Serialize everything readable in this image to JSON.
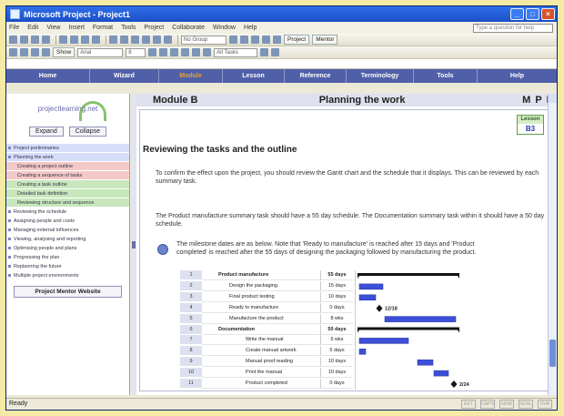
{
  "window": {
    "title": "Microsoft Project - Project1"
  },
  "menu": {
    "items": [
      "File",
      "Edit",
      "View",
      "Insert",
      "Format",
      "Tools",
      "Project",
      "Collaborate",
      "Window",
      "Help"
    ],
    "help_placeholder": "Type a question for help"
  },
  "toolbar": {
    "group_select": "No Group",
    "show_label": "Show",
    "font_select": "Arial",
    "size_select": "8",
    "filter_select": "All Tasks",
    "project_button": "Project",
    "mentor_button": "Mentor"
  },
  "nav": {
    "items": [
      "Home",
      "Wizard",
      "Module",
      "Lesson",
      "Reference",
      "Terminology",
      "Tools",
      "Help"
    ]
  },
  "sidebar": {
    "logo_text": "projectlearning.net",
    "expand_label": "Expand",
    "collapse_label": "Collapse",
    "items": [
      {
        "label": "Project preliminaries",
        "style": "blue",
        "sub": false
      },
      {
        "label": "Planning the work",
        "style": "blue",
        "sub": false
      },
      {
        "label": "Creating a project outline",
        "style": "red",
        "sub": true
      },
      {
        "label": "Creating a sequence of tasks",
        "style": "red",
        "sub": true
      },
      {
        "label": "Creating a task outline",
        "style": "green",
        "sub": true
      },
      {
        "label": "Detailed task definition",
        "style": "green",
        "sub": true
      },
      {
        "label": "Reviewing structure and sequence",
        "style": "green",
        "sub": true
      },
      {
        "label": "Reviewing the schedule",
        "style": "",
        "sub": false
      },
      {
        "label": "Assigning people and costs",
        "style": "",
        "sub": false
      },
      {
        "label": "Managing external influences",
        "style": "",
        "sub": false
      },
      {
        "label": "Viewing, analysing and reporting",
        "style": "",
        "sub": false
      },
      {
        "label": "Optimising people and plans",
        "style": "",
        "sub": false
      },
      {
        "label": "Progressing the plan",
        "style": "",
        "sub": false
      },
      {
        "label": "Replanning the future",
        "style": "",
        "sub": false
      },
      {
        "label": "Multiple project environments",
        "style": "",
        "sub": false
      }
    ],
    "website_button": "Project Mentor Website"
  },
  "content": {
    "module_label": "Module B",
    "page_title": "Planning the work",
    "mpe": [
      "M",
      "P",
      "E"
    ],
    "lesson_label": "Lesson",
    "lesson_number": "B3",
    "heading": "Reviewing the tasks and the outline",
    "para1": "To confirm the effect upon the project, you should review the Gantt chart and the schedule that it displays. This can be reviewed by each summary task.",
    "para2": "The Product manufacture summary task should have a 55 day schedule.  The Documentation summary task within it should have a 50 day schedule.",
    "para3": "The milestone dates are as below.  Note that 'Ready to manufacture' is reached after 15 days and 'Product completed' is reached after the 55 days of designing the packaging followed by manufacturing the product."
  },
  "gantt": {
    "tasks": [
      {
        "id": "1",
        "name": "Product manufacture",
        "duration": "55 days",
        "summary": true
      },
      {
        "id": "2",
        "name": "Design the packaging",
        "duration": "15 days",
        "summary": false
      },
      {
        "id": "3",
        "name": "Final product testing",
        "duration": "10 days",
        "summary": false
      },
      {
        "id": "4",
        "name": "Ready to manufacture",
        "duration": "0 days",
        "summary": false
      },
      {
        "id": "5",
        "name": "Manufacture the product",
        "duration": "8 wks",
        "summary": false
      },
      {
        "id": "6",
        "name": "Documentation",
        "duration": "50 days",
        "summary": true
      },
      {
        "id": "7",
        "name": "Write the manual",
        "duration": "6 wks",
        "summary": false
      },
      {
        "id": "8",
        "name": "Create manual artwork",
        "duration": "5 days",
        "summary": false
      },
      {
        "id": "9",
        "name": "Manual proof reading",
        "duration": "10 days",
        "summary": false
      },
      {
        "id": "10",
        "name": "Print the manual",
        "duration": "10 days",
        "summary": false
      },
      {
        "id": "11",
        "name": "Product completed",
        "duration": "0 days",
        "summary": false
      }
    ],
    "milestone_labels": {
      "ready": "12/18",
      "completed": "2/24"
    },
    "bar_color": "#3c4fd8"
  },
  "status": {
    "text": "Ready",
    "indicators": [
      "EXT",
      "CAPS",
      "NUM",
      "SCRL",
      "OVR"
    ]
  }
}
